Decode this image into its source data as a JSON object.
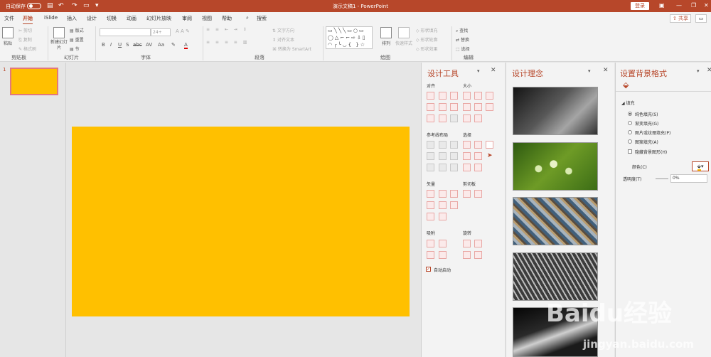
{
  "titlebar": {
    "autosave_label": "自动保存",
    "qat_icons": [
      "save-icon",
      "undo-icon",
      "redo-icon",
      "present-icon",
      "customize-icon"
    ],
    "document_title": "演示文稿1 - PowerPoint",
    "login_label": "登录"
  },
  "tabs": [
    "文件",
    "开始",
    "iSlide",
    "插入",
    "设计",
    "切换",
    "动画",
    "幻灯片放映",
    "审阅",
    "视图",
    "帮助",
    "搜索"
  ],
  "active_tab": "开始",
  "share_label": "共享",
  "ribbon": {
    "clipboard": {
      "paste": "粘贴",
      "cut": "剪切",
      "copy": "复制",
      "format_painter": "格式刷",
      "label": "剪贴板"
    },
    "slides": {
      "new_slide": "新建幻灯片",
      "layout": "版式",
      "reset": "重置",
      "section": "节",
      "label": "幻灯片"
    },
    "font": {
      "size_placeholder": "24+",
      "label": "字体",
      "format_buttons": [
        "B",
        "I",
        "U",
        "S",
        "abc",
        "AV",
        "Aa",
        "A",
        "A"
      ]
    },
    "paragraph": {
      "text_direction": "文字方向",
      "align_text": "对齐文本",
      "smartart": "转换为 SmartArt",
      "label": "段落"
    },
    "drawing": {
      "arrange": "排列",
      "quick_styles": "快速样式",
      "shape_fill": "形状填充",
      "shape_outline": "形状轮廓",
      "shape_effects": "形状效果",
      "label": "绘图"
    },
    "editing": {
      "find": "查找",
      "replace": "替换",
      "select": "选择",
      "label": "编辑"
    }
  },
  "thumbnail": {
    "number": "1",
    "fill": "#ffc000"
  },
  "slide": {
    "fill": "#ffc000"
  },
  "design_tools": {
    "title": "设计工具",
    "sections": {
      "align": "对齐",
      "size": "大小",
      "guides": "参考线布局",
      "select": "选择",
      "vector": "矢量",
      "clipboard": "剪切板",
      "snap": "吸附",
      "rotate": "旋转"
    },
    "auto_start": "自动启动"
  },
  "design_ideas": {
    "title": "设计理念",
    "images": [
      "photo-abstract-chart",
      "photo-water-drops",
      "photo-pebbles",
      "photo-steel-structure",
      "photo-light-trails"
    ]
  },
  "format_background": {
    "title": "设置背景格式",
    "fill_section": "填充",
    "options": [
      "纯色填充(S)",
      "渐变填充(G)",
      "图片或纹理填充(P)",
      "图案填充(A)"
    ],
    "selected_option": "纯色填充(S)",
    "hide_graphics": "隐藏背景图形(H)",
    "color_label": "颜色(C)",
    "transparency_label": "透明度(T)",
    "transparency_value": "0%"
  },
  "watermark": {
    "brand": "Baidu经验",
    "url": "jingyan.baidu.com"
  },
  "colors": {
    "accent": "#b7472a",
    "slide_fill": "#ffc000"
  }
}
